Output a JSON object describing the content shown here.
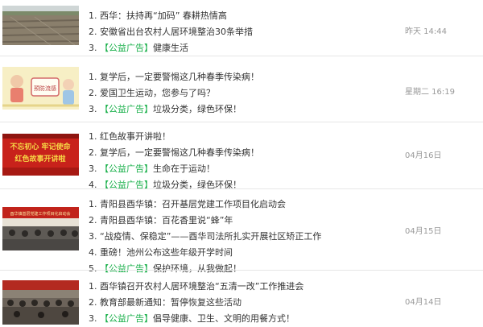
{
  "entries": [
    {
      "time": "昨天 14:44",
      "thumb": "field-photo",
      "lines": [
        {
          "num": "1.",
          "text": "西华：扶持再“加码” 春耕热情高"
        },
        {
          "num": "2.",
          "text": "安徽省出台农村人居环境整治30条举措"
        },
        {
          "num": "3.",
          "ad": "【公益广告】",
          "text": "健康生活"
        }
      ]
    },
    {
      "time": "星期二 16:19",
      "thumb": "cartoon-illustration",
      "lines": [
        {
          "num": "1.",
          "text": "复学后，一定要警惕这几种春季传染病！"
        },
        {
          "num": "2.",
          "text": "爱国卫生运动，您参与了吗？"
        },
        {
          "num": "3.",
          "ad": "【公益广告】",
          "text": "垃圾分类，绿色环保！"
        }
      ]
    },
    {
      "time": "04月16日",
      "thumb": "red-banner",
      "lines": [
        {
          "num": "1.",
          "text": "红色故事开讲啦！"
        },
        {
          "num": "2.",
          "text": "复学后，一定要警惕这几种春季传染病！"
        },
        {
          "num": "3.",
          "ad": "【公益广告】",
          "text": "生命在于运动！"
        },
        {
          "num": "4.",
          "ad": "【公益广告】",
          "text": "垃圾分类，绿色环保！"
        }
      ]
    },
    {
      "time": "04月15日",
      "thumb": "meeting-photo",
      "lines": [
        {
          "num": "1.",
          "text": "青阳县酉华镇：召开基层党建工作项目化启动会"
        },
        {
          "num": "2.",
          "text": "青阳县酉华镇：百花香里说“蜂”年"
        },
        {
          "num": "3.",
          "text": "“战疫情、保稳定”——酉华司法所扎实开展社区矫正工作"
        },
        {
          "num": "4.",
          "text": "重磅！池州公布这些年级开学时间"
        },
        {
          "num": "5.",
          "ad": "【公益广告】",
          "text": "保护环境，从我做起！"
        }
      ]
    },
    {
      "time": "04月14日",
      "thumb": "conference-photo",
      "lines": [
        {
          "num": "1.",
          "text": "酉华镇召开农村人居环境整治“五清一改”工作推进会"
        },
        {
          "num": "2.",
          "text": "教育部最新通知：暂停恢复这些活动"
        },
        {
          "num": "3.",
          "ad": "【公益广告】",
          "text": "倡导健康、卫生、文明的用餐方式！"
        }
      ]
    }
  ],
  "thumb_labels": {
    "cartoon": "预防流感",
    "banner_top": "不忘初心 牢记使命",
    "banner_bottom": "红色故事开讲啦",
    "meeting_banner": "酉华镇基层党建工作项目化启动会"
  },
  "colors": {
    "ad": "#19b04a",
    "time": "#999999",
    "separator": "#e6e6e6"
  }
}
